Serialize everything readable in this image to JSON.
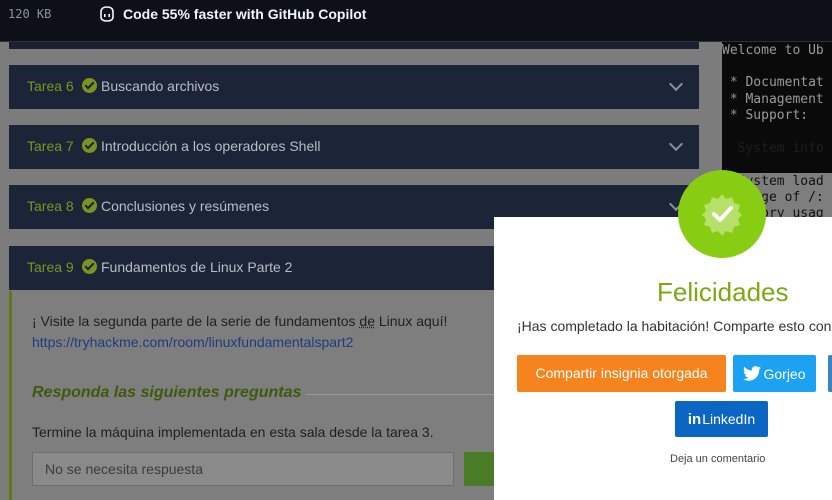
{
  "topbar": {
    "size": "120 KB",
    "promo": "Code 55% faster with GitHub Copilot"
  },
  "tasks": [
    {
      "num": "Tarea 6",
      "title": "Buscando archivos"
    },
    {
      "num": "Tarea 7",
      "title": "Introducción a los operadores Shell"
    },
    {
      "num": "Tarea 8",
      "title": "Conclusiones y resúmenes"
    },
    {
      "num": "Tarea 9",
      "title": "Fundamentos de Linux Parte 2"
    }
  ],
  "task9": {
    "text_part1": "¡ Visite la segunda parte de la serie de fundamentos ",
    "text_de": "de",
    "text_part2": " Linux aquí! ",
    "link": "https://tryhackme.com/room/linuxfundamentalspart2",
    "answer_heading": "Responda las siguientes preguntas",
    "question": "Termine la máquina implementada en esta sala desde la tarea 3.",
    "answer_placeholder": "No se necesita respuesta"
  },
  "terminal": {
    "lines": [
      "Welcome to Ub",
      " * Documentat",
      " * Management",
      " * Support:",
      "  System info",
      "  System load",
      "  Usage of /:",
      "  Memory usag"
    ]
  },
  "modal": {
    "title": "Felicidades",
    "subtitle": "¡Has completado la habitación! Comparte esto con",
    "share_button": "Compartir insignia otorgada",
    "twitter_button": "Gorjeo",
    "linkedin_in": "in",
    "linkedin_button": "LinkedIn",
    "comment": "Deja un comentario"
  },
  "colors": {
    "accent_green": "#88cc14",
    "task_bg": "#1c2438",
    "share_orange": "#f5841f",
    "twitter_blue": "#1da1f2",
    "linkedin_blue": "#0a66c2"
  }
}
